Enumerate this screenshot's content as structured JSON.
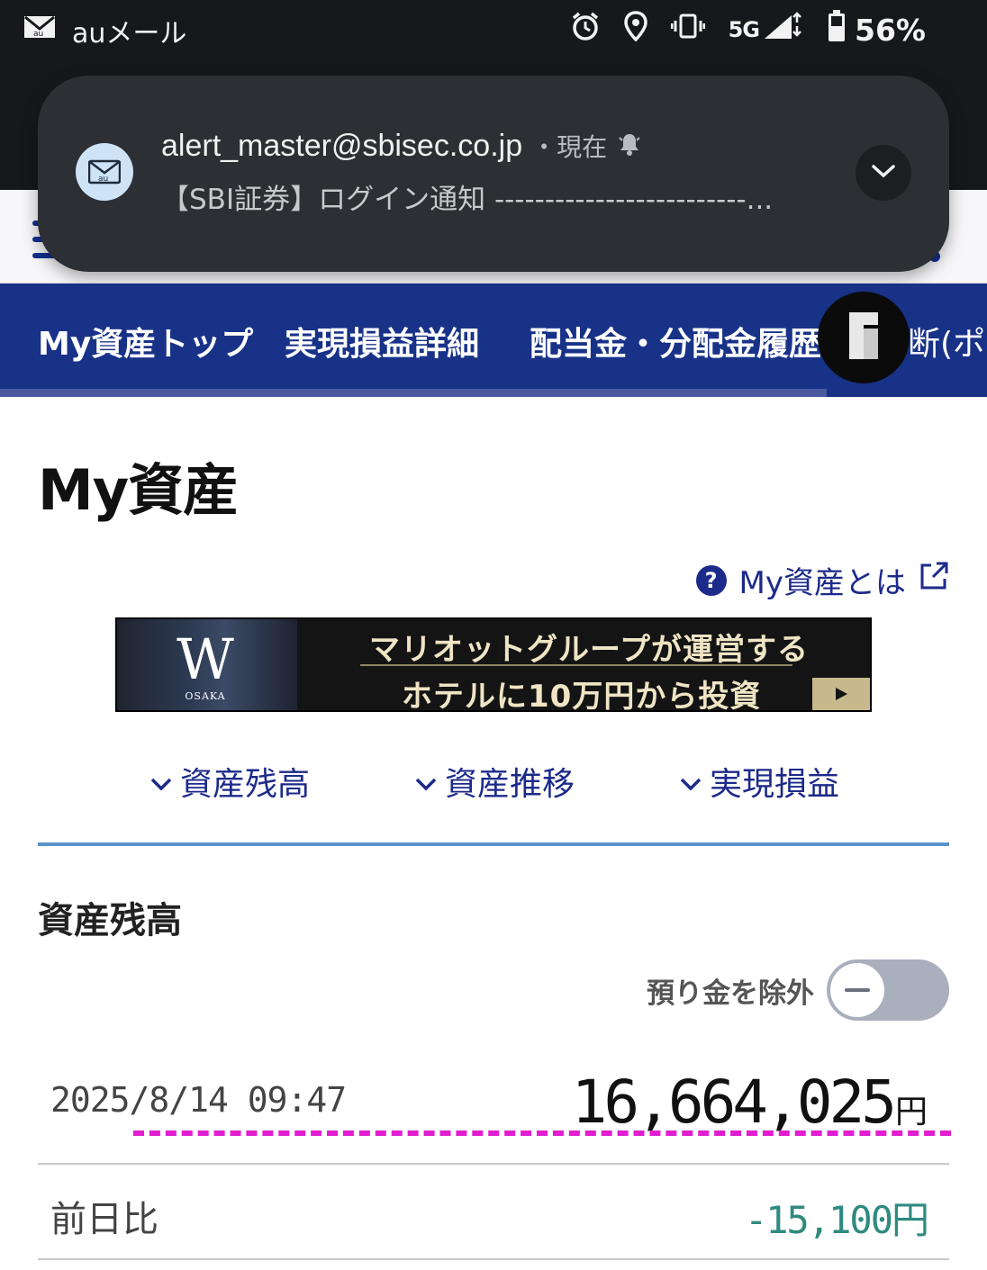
{
  "status_bar": {
    "app_name": "auメール",
    "network": "5G",
    "battery": "56%",
    "icons": [
      "mail-icon",
      "alarm-icon",
      "location-icon",
      "vibrate-icon",
      "signal-icon",
      "battery-icon"
    ]
  },
  "notification": {
    "sender": "alert_master@sbisec.co.jp",
    "time": "・現在",
    "preview": "【SBI証券】ログイン通知 -------------------------..."
  },
  "tabs": [
    {
      "label": "My資産トップ"
    },
    {
      "label": "実現損益詳細"
    },
    {
      "label": "配当金・分配金履歴"
    },
    {
      "label": "断(ポ"
    }
  ],
  "page": {
    "title": "My資産",
    "help_link": "My資産とは"
  },
  "banner": {
    "logo": "W",
    "logo_sub": "OSAKA",
    "line1": "マリオットグループが運営する",
    "line2": "ホテルに10万円から投資"
  },
  "anchors": [
    {
      "label": "資産残高"
    },
    {
      "label": "資産推移"
    },
    {
      "label": "実現損益"
    }
  ],
  "balance": {
    "section_title": "資産残高",
    "toggle_label": "預り金を除外",
    "toggle_on": false,
    "timestamp": "2025/8/14 09:47",
    "total": "16,664,025",
    "currency": "円",
    "prev_day_label": "前日比",
    "prev_day_value": "-15,100円"
  },
  "colors": {
    "nav": "#183288",
    "link": "#1c2a8a",
    "negative_change": "#2f8a80",
    "annotation": "#e01ed0"
  }
}
